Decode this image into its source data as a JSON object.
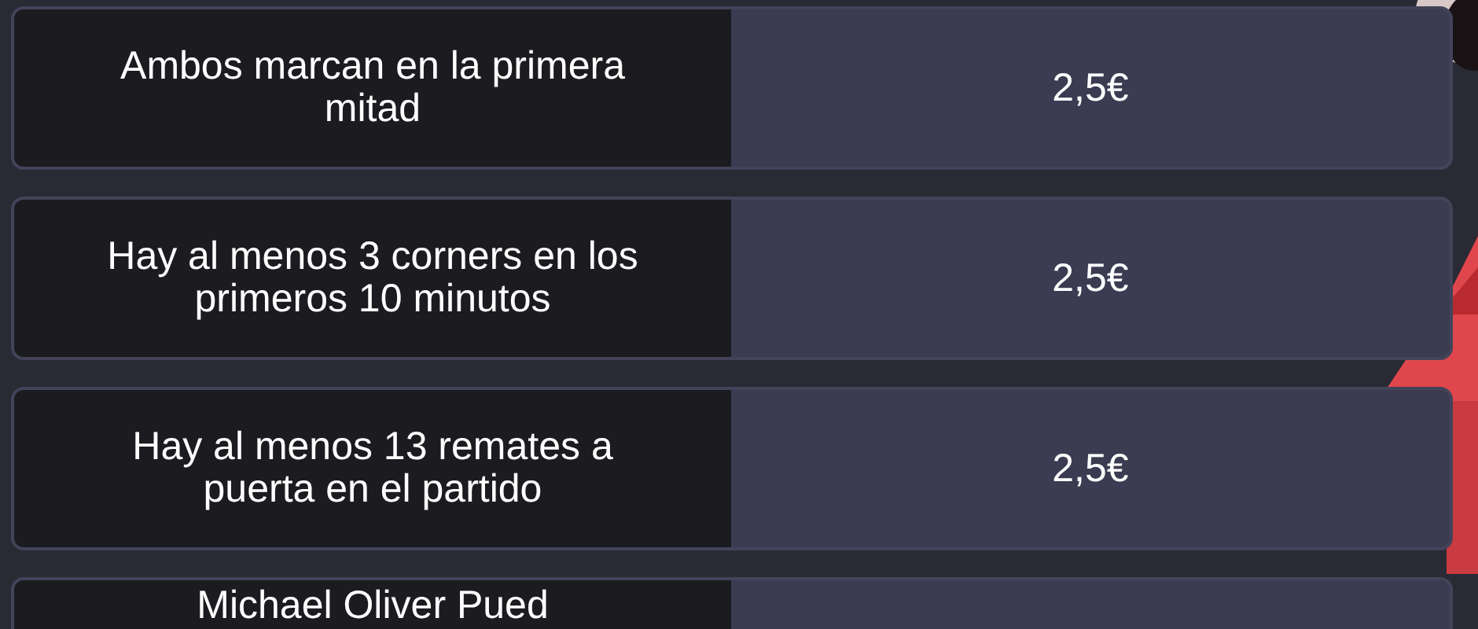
{
  "bets": [
    {
      "description": "Ambos marcan en la primera mitad",
      "price": "2,5€"
    },
    {
      "description": "Hay al menos 3 corners en los primeros 10 minutos",
      "price": "2,5€"
    },
    {
      "description": "Hay al menos 13 remates a puerta en el partido",
      "price": "2,5€"
    },
    {
      "description": "Michael Oliver Pued"
    }
  ]
}
